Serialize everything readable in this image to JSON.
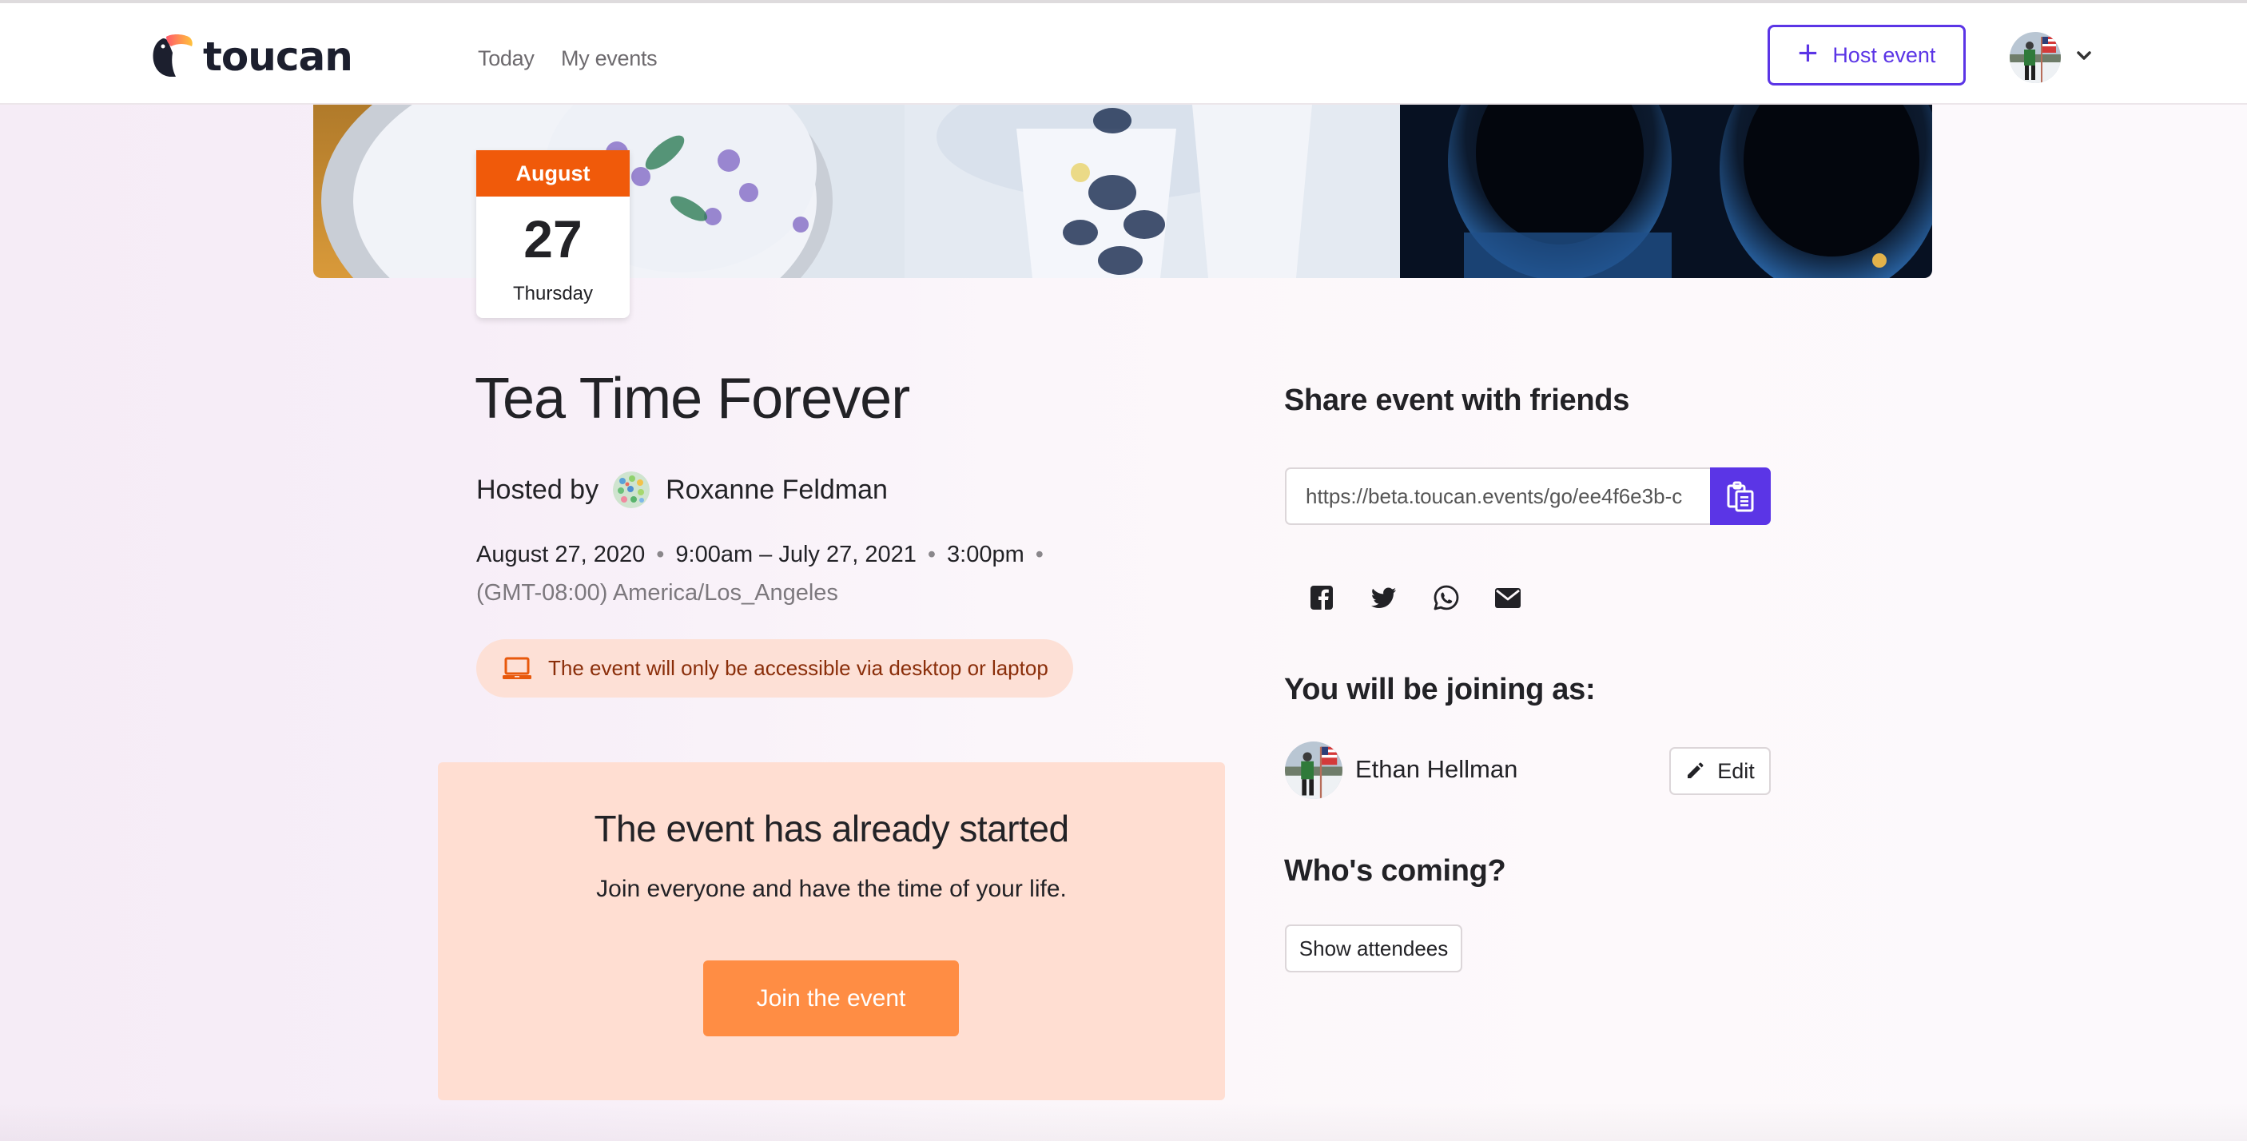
{
  "header": {
    "logo_text": "toucan",
    "nav": [
      {
        "label": "Today"
      },
      {
        "label": "My events"
      }
    ],
    "host_button": {
      "icon": "plus-icon",
      "label": "Host event"
    },
    "user_menu": {
      "avatar": "user-avatar",
      "icon": "chevron-down-icon"
    }
  },
  "event": {
    "date_card": {
      "month": "August",
      "day": "27",
      "weekday": "Thursday"
    },
    "title": "Tea Time Forever",
    "hosted_by_label": "Hosted by",
    "host_name": "Roxanne Feldman",
    "schedule": {
      "start_date": "August 27, 2020",
      "start_time_range": "9:00am – July 27, 2021",
      "end_time": "3:00pm",
      "separator": "•",
      "timezone": "(GMT-08:00) America/Los_Angeles"
    },
    "notice": {
      "icon": "laptop-icon",
      "text": "The event will only be accessible via desktop or laptop"
    },
    "status_box": {
      "heading": "The event has already started",
      "message": "Join everyone and have the time of your life.",
      "join_button": "Join the event"
    }
  },
  "share": {
    "heading": "Share event with friends",
    "url": "https://beta.toucan.events/go/ee4f6e3b-c",
    "copy_icon": "clipboard-icon",
    "social": [
      "facebook-icon",
      "twitter-icon",
      "whatsapp-icon",
      "email-icon"
    ]
  },
  "joining": {
    "heading": "You will be joining as:",
    "name": "Ethan Hellman",
    "edit_button": "Edit"
  },
  "attendees": {
    "heading": "Who's coming?",
    "button": "Show attendees"
  },
  "colors": {
    "brand_purple": "#5b35e6",
    "date_orange": "#f05a0a",
    "join_orange": "#ff8d44",
    "notice_bg": "#fde0d6",
    "notice_text": "#8a2e0a",
    "status_bg": "#ffded2"
  }
}
